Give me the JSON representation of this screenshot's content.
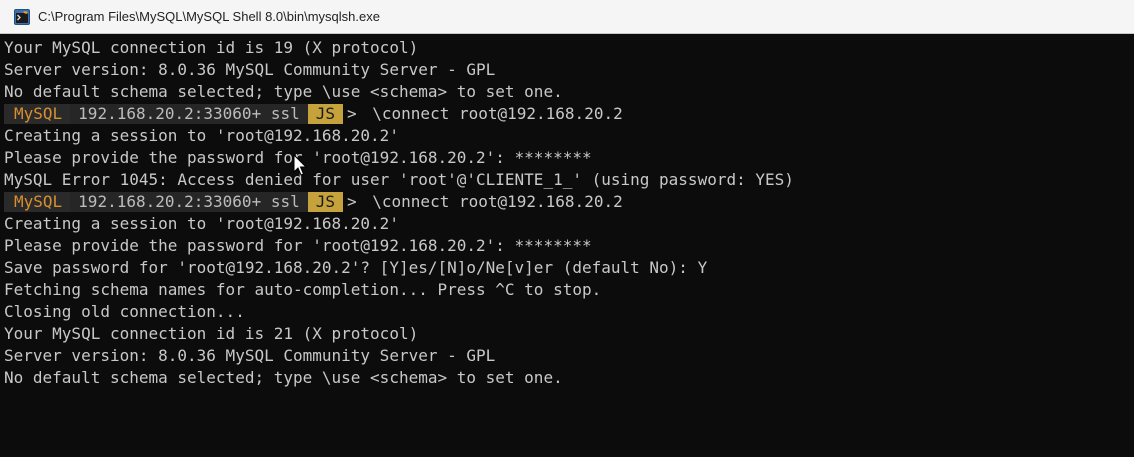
{
  "window": {
    "title": "C:\\Program Files\\MySQL\\MySQL Shell 8.0\\bin\\mysqlsh.exe",
    "icon": "terminal-icon"
  },
  "colors": {
    "background": "#0c0c0c",
    "text": "#c8c8c8",
    "prompt_mysql": "#d9902f",
    "prompt_mode_bg": "#c5a23b"
  },
  "prompt": {
    "mysql_label": "MySQL",
    "host_label": "192.168.20.2:33060+ ssl",
    "mode_label": "JS",
    "arrow": "> "
  },
  "console": {
    "lines": [
      {
        "type": "text",
        "text": "Your MySQL connection id is 19 (X protocol)"
      },
      {
        "type": "text",
        "text": "Server version: 8.0.36 MySQL Community Server - GPL"
      },
      {
        "type": "text",
        "text": "No default schema selected; type \\use <schema> to set one."
      },
      {
        "type": "prompt",
        "command": "\\connect root@192.168.20.2"
      },
      {
        "type": "text",
        "text": "Creating a session to 'root@192.168.20.2'"
      },
      {
        "type": "text",
        "text": "Please provide the password for 'root@192.168.20.2': ********"
      },
      {
        "type": "text",
        "text": "MySQL Error 1045: Access denied for user 'root'@'CLIENTE_1_' (using password: YES)"
      },
      {
        "type": "prompt",
        "command": "\\connect root@192.168.20.2"
      },
      {
        "type": "text",
        "text": "Creating a session to 'root@192.168.20.2'"
      },
      {
        "type": "text",
        "text": "Please provide the password for 'root@192.168.20.2': ********"
      },
      {
        "type": "text",
        "text": "Save password for 'root@192.168.20.2'? [Y]es/[N]o/Ne[v]er (default No): Y"
      },
      {
        "type": "text",
        "text": "Fetching schema names for auto-completion... Press ^C to stop."
      },
      {
        "type": "text",
        "text": "Closing old connection..."
      },
      {
        "type": "text",
        "text": "Your MySQL connection id is 21 (X protocol)"
      },
      {
        "type": "text",
        "text": "Server version: 8.0.36 MySQL Community Server - GPL"
      },
      {
        "type": "text",
        "text": "No default schema selected; type \\use <schema> to set one."
      }
    ]
  }
}
